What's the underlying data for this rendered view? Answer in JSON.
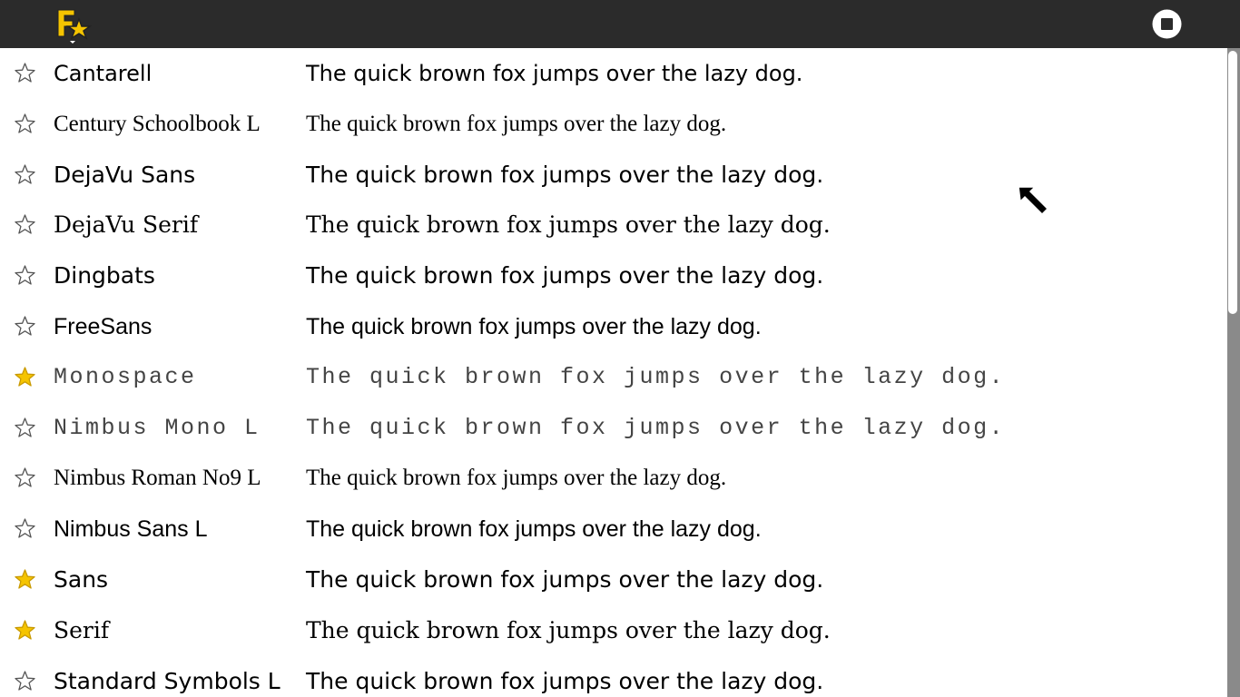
{
  "toolbar": {
    "activity_icon": "fonts-activity-icon",
    "stop_icon": "stop-icon",
    "background": "#2b2b2b"
  },
  "fonts": [
    {
      "name": "Cantarell",
      "sample": "The quick brown fox jumps over the lazy dog.",
      "favorite": false
    },
    {
      "name": "Century Schoolbook L",
      "sample": "The quick brown fox jumps over the lazy dog.",
      "favorite": false
    },
    {
      "name": "DejaVu Sans",
      "sample": "The quick brown fox jumps over the lazy dog.",
      "favorite": false
    },
    {
      "name": "DejaVu Serif",
      "sample": "The quick brown fox jumps over the lazy dog.",
      "favorite": false
    },
    {
      "name": "Dingbats",
      "sample": "The quick brown fox jumps over the lazy dog.",
      "favorite": false
    },
    {
      "name": "FreeSans",
      "sample": "The quick brown fox jumps over the lazy dog.",
      "favorite": false
    },
    {
      "name": "Monospace",
      "sample": "The quick brown fox jumps over the lazy dog.",
      "favorite": true
    },
    {
      "name": "Nimbus Mono L",
      "sample": "The quick brown fox jumps over the lazy dog.",
      "favorite": false
    },
    {
      "name": "Nimbus Roman No9 L",
      "sample": "The quick brown fox jumps over the lazy dog.",
      "favorite": false
    },
    {
      "name": "Nimbus Sans L",
      "sample": "The quick brown fox jumps over the lazy dog.",
      "favorite": false
    },
    {
      "name": "Sans",
      "sample": "The quick brown fox jumps over the lazy dog.",
      "favorite": true
    },
    {
      "name": "Serif",
      "sample": "The quick brown fox jumps over the lazy dog.",
      "favorite": true
    },
    {
      "name": "Standard Symbols L",
      "sample": "The quick brown fox jumps over the lazy dog.",
      "favorite": false
    }
  ],
  "colors": {
    "star_filled": "#f5c400",
    "star_outline": "#555555"
  }
}
